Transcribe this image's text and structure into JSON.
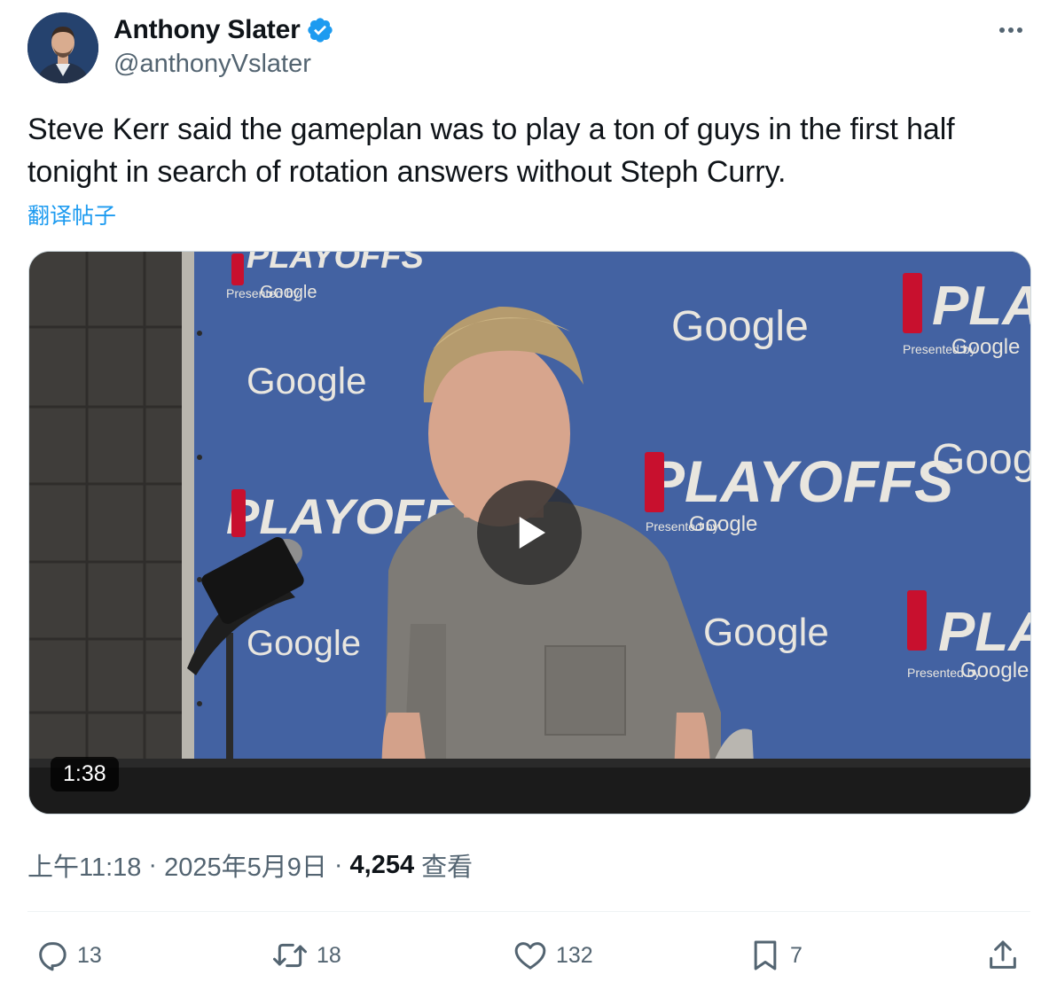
{
  "author": {
    "display_name": "Anthony Slater",
    "handle": "@anthonyVslater",
    "verified": true,
    "avatar_icon": "profile-photo"
  },
  "tweet": {
    "text": "Steve Kerr said the gameplan was to play a ton of guys in the first half tonight in search of rotation answers without Steph Curry.",
    "translate_label": "翻译帖子"
  },
  "media": {
    "type": "video",
    "duration": "1:38",
    "play_icon": "play-icon",
    "backdrop_words": {
      "google": "Google",
      "playoffs": "PLAYOFFS",
      "presented_by": "Presented by"
    }
  },
  "meta": {
    "time": "上午11:18",
    "date": "2025年5月9日",
    "separator": "·",
    "views_count": "4,254",
    "views_label": "查看"
  },
  "actions": {
    "reply_count": "13",
    "repost_count": "18",
    "like_count": "132",
    "bookmark_count": "7"
  },
  "colors": {
    "accent": "#1d9bf0",
    "text_primary": "#0f1419",
    "text_secondary": "#536471",
    "backdrop_blue": "#3e5d9c"
  }
}
